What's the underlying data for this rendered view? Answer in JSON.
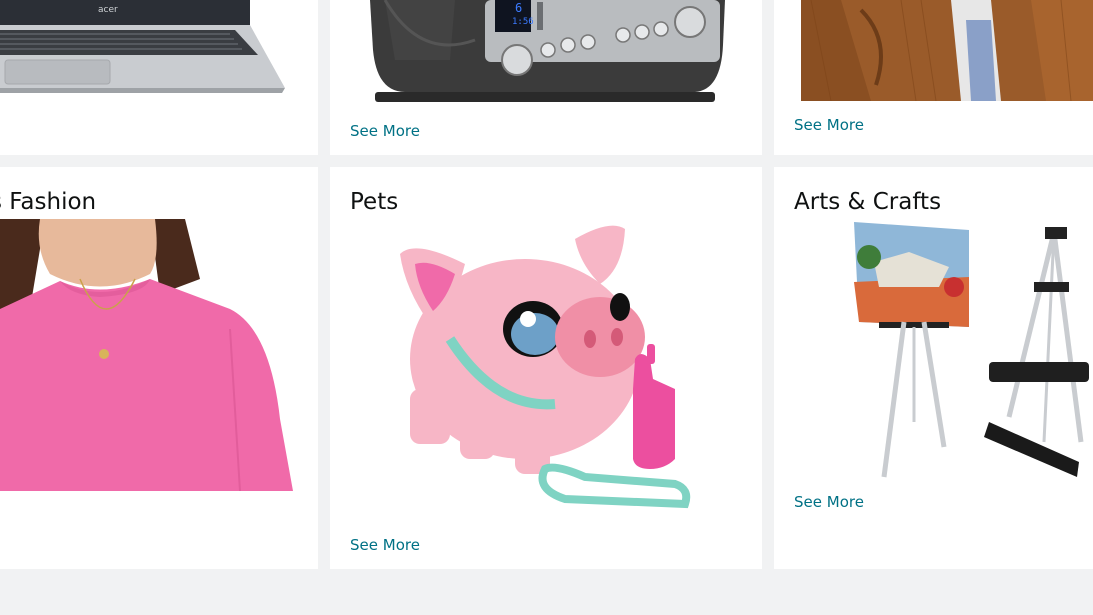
{
  "cards": {
    "laptops": {
      "label": ""
    },
    "toasters": {
      "see_more": "See More"
    },
    "jackets": {
      "see_more": "See More"
    },
    "womens_fashion": {
      "title": "s Fashion"
    },
    "pets": {
      "title": "Pets",
      "see_more": "See More"
    },
    "arts_crafts": {
      "title": "Arts & Crafts",
      "see_more": "See More"
    }
  },
  "toaster_display": {
    "top": "6",
    "bottom": "1:56"
  },
  "laptop_brand": "acer",
  "colors": {
    "link": "#007185",
    "background": "#f1f2f3",
    "card": "#ffffff"
  }
}
